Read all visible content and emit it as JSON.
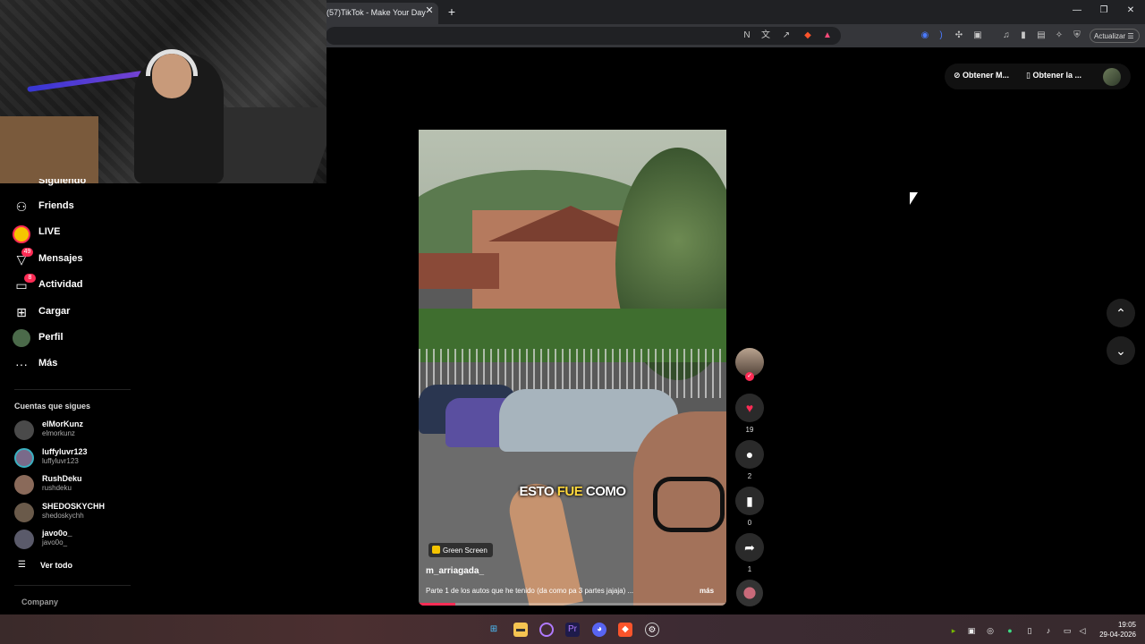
{
  "browser": {
    "tab_title": "(57)TikTok - Make Your Day",
    "tab_close": "✕",
    "new_tab": "+",
    "update_label": "Actualizar",
    "window_controls": {
      "minimize": "—",
      "restore": "❐",
      "close": "✕"
    }
  },
  "sidebar": {
    "partial_item": "Siguiendo",
    "items": [
      {
        "label": "Friends",
        "icon": "friends-icon"
      },
      {
        "label": "LIVE",
        "icon": "live-icon"
      },
      {
        "label": "Mensajes",
        "icon": "messages-icon",
        "badge": "49"
      },
      {
        "label": "Actividad",
        "icon": "activity-icon",
        "badge": "8"
      },
      {
        "label": "Cargar",
        "icon": "upload-icon"
      },
      {
        "label": "Perfil",
        "icon": "profile-avatar"
      },
      {
        "label": "Más",
        "icon": "more-icon"
      }
    ],
    "following_title": "Cuentas que sigues",
    "accounts": [
      {
        "name": "elMorKunz",
        "handle": "elmorkunz",
        "color": "#4a4a4a"
      },
      {
        "name": "luffyluvr123",
        "handle": "luffyluvr123",
        "color": "#7a6a8a"
      },
      {
        "name": "RushDeku",
        "handle": "rushdeku",
        "color": "#8a6a5a"
      },
      {
        "name": "SHEDOSKYCHH",
        "handle": "shedoskychh",
        "color": "#6a5a4a"
      },
      {
        "name": "javo0o_",
        "handle": "javo0o_",
        "color": "#5a5a6a"
      }
    ],
    "see_all": "Ver todo",
    "company": "Company"
  },
  "header_actions": {
    "get_app_1": "Obtener M...",
    "get_app_2": "Obtener la ..."
  },
  "video": {
    "caption_pre": "ESTO ",
    "caption_hl": "FUE",
    "caption_post": " COMO",
    "effect_badge": "Green Screen",
    "author": "m_arriagada_",
    "description": "Parte 1 de los autos que he tenido (da como pa 3 partes jajaja) ...",
    "more": "más",
    "progress_percent": 12
  },
  "actions": {
    "likes": "19",
    "comments": "2",
    "saves": "0",
    "shares": "1"
  },
  "taskbar": {
    "time": "19:05",
    "date": "29-04-2026"
  },
  "colors": {
    "accent": "#fe2c55",
    "background": "#000000"
  }
}
